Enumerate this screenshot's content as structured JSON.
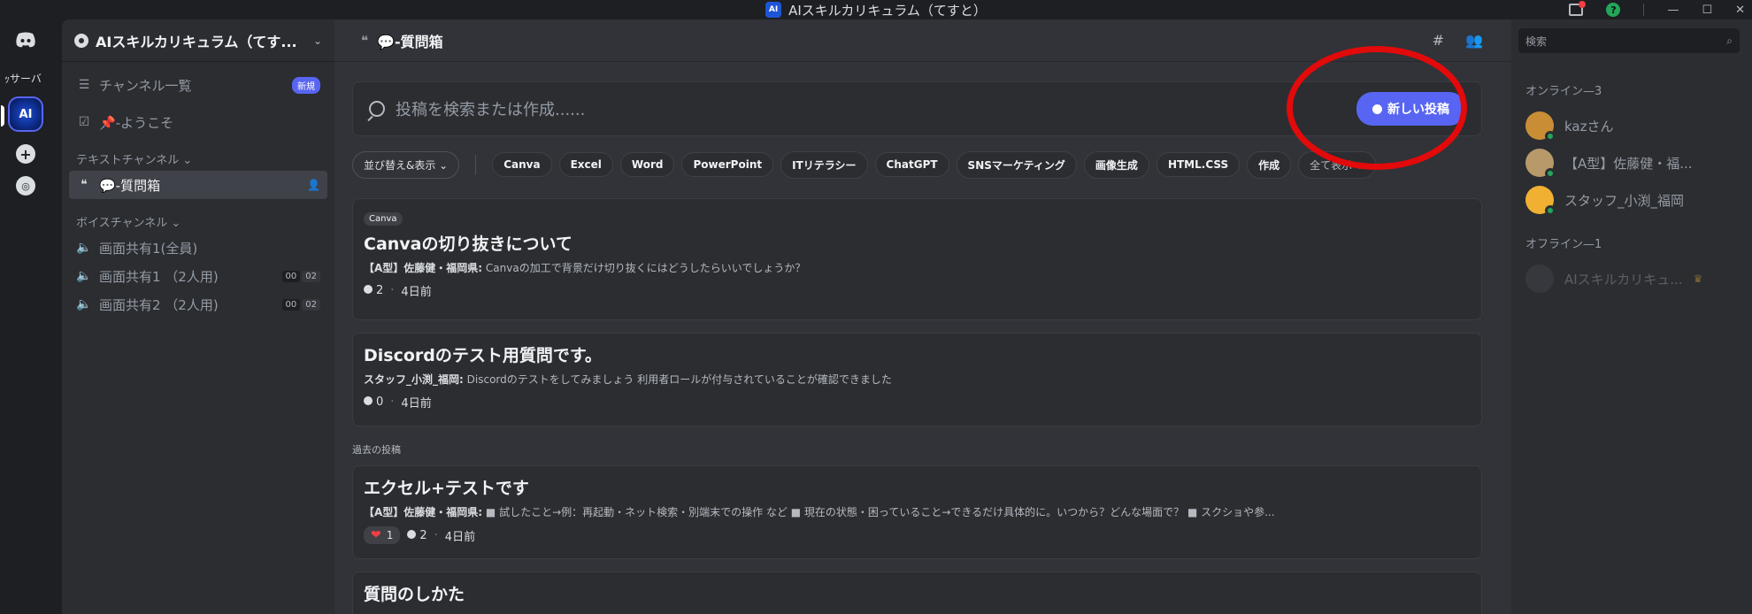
{
  "window": {
    "title": "AIスキルカリキュラム（てすと）",
    "app_icon_text": "AI",
    "help_icon_text": "?"
  },
  "rail": {
    "label": "ｯサーバ",
    "server_icon_text": "AI"
  },
  "sidebar": {
    "server_name": "AIスキルカリキュラム（てす...",
    "items": [
      {
        "label": "チャンネル一覧",
        "badge": "新規"
      },
      {
        "label": "📌-ようこそ"
      }
    ],
    "text_category": "テキストチャンネル",
    "active_channel": "💬-質問箱",
    "voice_category": "ボイスチャンネル",
    "voice_channels": [
      {
        "label": "画面共有1(全員)"
      },
      {
        "label": "画面共有1 （2人用)",
        "badge_a": "00",
        "badge_b": "02"
      },
      {
        "label": "画面共有2 （2人用)",
        "badge_a": "00",
        "badge_b": "02"
      }
    ]
  },
  "main": {
    "channel_title": "💬-質問箱",
    "search_placeholder": "投稿を検索または作成......",
    "new_post_label": "新しい投稿",
    "sort_label": "並び替え&表示 ⌄",
    "tags": [
      "Canva",
      "Excel",
      "Word",
      "PowerPoint",
      "ITリテラシー",
      "ChatGPT",
      "SNSマーケティング",
      "画像生成",
      "HTML.CSS",
      "作成"
    ],
    "show_all_label": "全て表示 ⌄",
    "posts": [
      {
        "tag": "Canva",
        "title": "Canvaの切り抜きについて",
        "author": "【A型】佐藤健・福岡県:",
        "message": "Canvaの加工で背景だけ切り抜くにはどうしたらいいでしょうか？",
        "comments": "2",
        "time": "4日前"
      },
      {
        "title": "Discordのテスト用質問です。",
        "author": "スタッフ_小渕_福岡:",
        "message": "Discordのテストをしてみましょう 利用者ロールが付与されていることが確認できました",
        "comments": "0",
        "time": "4日前"
      }
    ],
    "past_label": "過去の投稿",
    "past_posts": [
      {
        "title": "エクセル+テストです",
        "author": "【A型】佐藤健・福岡県:",
        "message": "■ 試したこと→例：再起動・ネット検索・別端末での操作 など ■ 現在の状態・困っていること→できるだけ具体的に。いつから？どんな場面で？ ■ スクショや参...",
        "reactions": "1",
        "comments": "2",
        "time": "4日前"
      },
      {
        "title": "質問のしかた"
      }
    ]
  },
  "members": {
    "search_placeholder": "検索",
    "online_label": "オンライン—3",
    "online": [
      {
        "name": "kazさん"
      },
      {
        "name": "【A型】佐藤健・福..."
      },
      {
        "name": "スタッフ_小渕_福岡"
      }
    ],
    "offline_label": "オフライン—1",
    "offline": [
      {
        "name": "AIスキルカリキュ..."
      }
    ]
  },
  "colors": {
    "accent": "#5865f2",
    "annotation": "#e20a0a",
    "online": "#23a55a"
  }
}
